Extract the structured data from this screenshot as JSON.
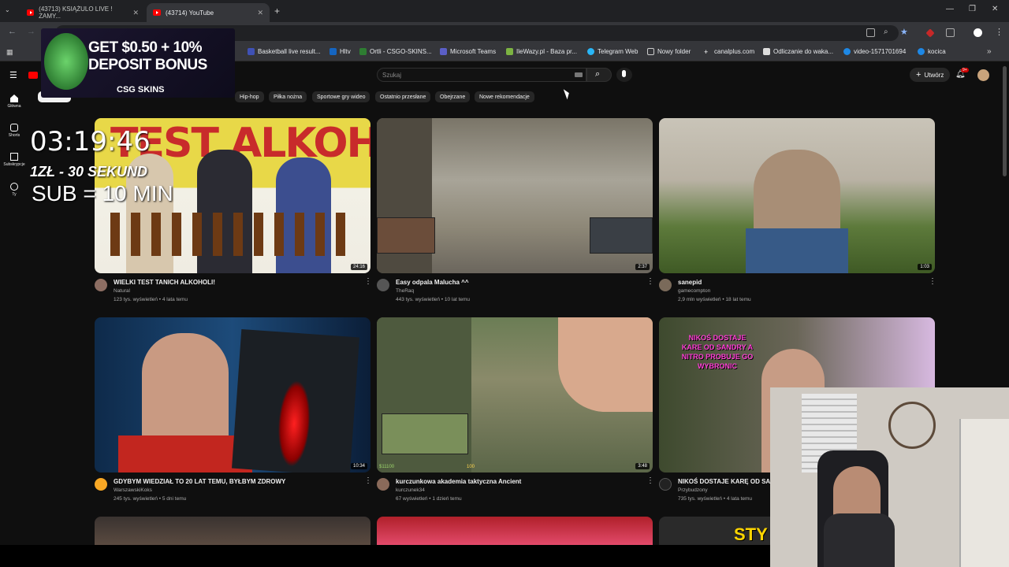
{
  "browser": {
    "tabs": [
      {
        "label": "(43713) KSIĄŻULO LIVE ! ZAMY..."
      },
      {
        "label": "(43714) YouTube"
      }
    ],
    "new_tab": "+",
    "bookmarks": [
      {
        "label": "Basketball live result..."
      },
      {
        "label": "Hltv"
      },
      {
        "label": "Ortli - CSGO-SKINS..."
      },
      {
        "label": "Microsoft Teams"
      },
      {
        "label": "IleWazy.pl - Baza pr..."
      },
      {
        "label": "Telegram Web"
      },
      {
        "label": "Nowy folder"
      },
      {
        "label": "canalplus.com"
      },
      {
        "label": "Odliczanie do waka..."
      },
      {
        "label": "video-1571701694"
      },
      {
        "label": "kocica"
      }
    ]
  },
  "youtube": {
    "search_placeholder": "Szukaj",
    "create_label": "Utwórz",
    "notification_count": "9+",
    "chips": [
      "Hip-hop",
      "Piłka nożna",
      "Sportowe gry wideo",
      "Ostatnio przesłane",
      "Obejrzane",
      "Nowe rekomendacje"
    ],
    "sidebar": [
      "Główna",
      "Shorts",
      "Subskrypcje",
      "Ty"
    ],
    "videos": [
      {
        "title": "WIELKI TEST TANICH ALKOHOLI!",
        "channel": "Natural",
        "meta": "123 tys. wyświetleń • 4 lata temu",
        "duration": "24:16",
        "thumb_text": "TEST ALKOHOLI"
      },
      {
        "title": "Easy odpala Malucha ^^",
        "channel": "TheRaq",
        "meta": "443 tys. wyświetleń • 10 lat temu",
        "duration": "2:37"
      },
      {
        "title": "sanepid",
        "channel": "gamecompton",
        "meta": "2,9 mln wyświetleń • 18 lat temu",
        "duration": "1:03"
      },
      {
        "title": "GDYBYM WIEDZIAŁ TO 20 LAT TEMU, BYŁBYM ZDROWY",
        "channel": "WarszawskiKoks",
        "meta": "245 tys. wyświetleń • 5 dni temu",
        "duration": "10:34"
      },
      {
        "title": "kurczunkowa akademia taktyczna Ancient",
        "channel": "kurczunek34",
        "meta": "67 wyświetleń • 1 dzień temu",
        "duration": "3:48",
        "hud_money": "$11100",
        "hud_ammo": "100"
      },
      {
        "title": "NIKOŚ DOSTAJE KARĘ OD SAND",
        "channel": "Przybudzony",
        "meta": "735 tys. wyświetleń • 4 lata temu",
        "thumb_text": "NIKOŚ DOSTAJE KARE OD SANDRY A NITRO PROBUJE GO WYBRONIC"
      }
    ],
    "partial_thumb_text": "STY"
  },
  "stream_overlay": {
    "ad_line1": "GET $0.50 + 10%",
    "ad_line2": "DEPOSIT BONUS",
    "ad_brand": "CSG SKINS",
    "timer": "03:19:46",
    "rate": "1ZŁ - 30 SEKUND",
    "sub": "SUB = 10 MIN"
  }
}
